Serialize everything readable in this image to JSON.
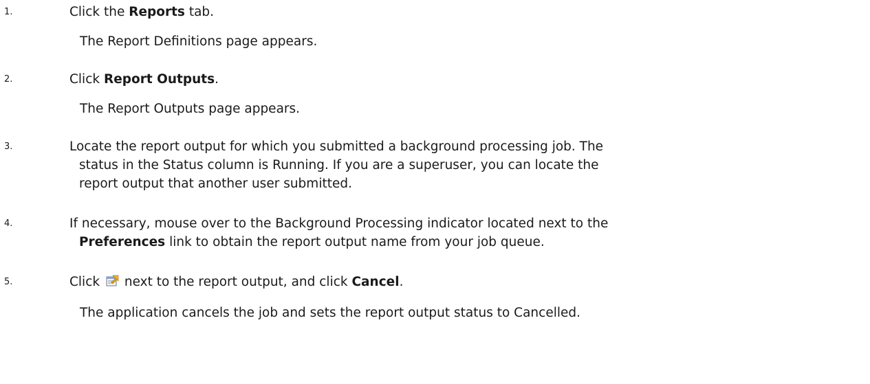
{
  "steps": [
    {
      "number": "1.",
      "pre": "Click the ",
      "bold": "Reports",
      "post": " tab.",
      "result": "The Report Definitions page appears."
    },
    {
      "number": "2.",
      "pre": "Click ",
      "bold": "Report Outputs",
      "post": ".",
      "result": "The Report Outputs page appears."
    },
    {
      "number": "3.",
      "line1": "Locate the report output for which you submitted a background processing job. The",
      "line2": "status in the Status column is Running. If you are a superuser, you can locate the",
      "line3": "report output that another user submitted."
    },
    {
      "number": "4.",
      "line1": "If necessary, mouse over to the Background Processing indicator located next to the",
      "line2_bold": "Preferences",
      "line2_post": " link to obtain the report output name from your job queue."
    },
    {
      "number": "5.",
      "pre": "Click ",
      "icon": "edit-properties-icon",
      "mid": " next to the report output, and click ",
      "bold": "Cancel",
      "post": ".",
      "result": "The application cancels the job and sets the report output status to Cancelled."
    }
  ]
}
